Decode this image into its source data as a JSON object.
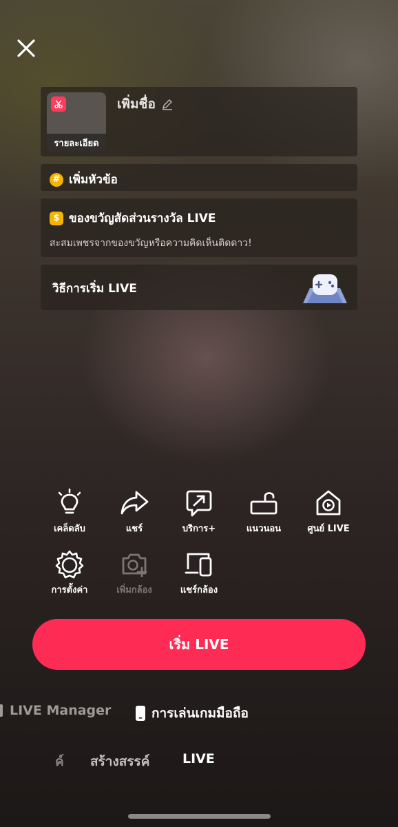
{
  "header": {
    "close_icon": "close-icon"
  },
  "title_card": {
    "add_title": "เพิ่มชื่อ",
    "thumbnail_label": "รายละเอียด",
    "edit_icon": "pencil-icon"
  },
  "topic": {
    "label": "เพิ่มหัวข้อ",
    "icon": "hash-icon"
  },
  "rewards": {
    "title": "ของขวัญสัดส่วนรางวัล LIVE",
    "subtitle": "สะสมเพชรจากของขวัญหรือความคิดเห็นติดดาว!",
    "icon": "dollar-icon"
  },
  "guide": {
    "label": "วิธีการเริ่ม LIVE",
    "icon": "gamepad-illustration"
  },
  "tools": [
    {
      "label": "เคล็ดลับ",
      "icon": "lightbulb-icon"
    },
    {
      "label": "แชร์",
      "icon": "share-icon"
    },
    {
      "label": "บริการ+",
      "icon": "service-icon"
    },
    {
      "label": "แนวนอน",
      "icon": "landscape-icon"
    },
    {
      "label": "ศูนย์ LIVE",
      "icon": "live-center-icon"
    },
    {
      "label": "การตั้งค่า",
      "icon": "settings-icon"
    },
    {
      "label": "เพิ่มกล้อง",
      "icon": "add-camera-icon"
    },
    {
      "label": "แชร์กล้อง",
      "icon": "share-camera-icon"
    }
  ],
  "start_button": {
    "label": "เริ่ม LIVE"
  },
  "modes": {
    "manager": "LIVE Manager",
    "mobile_gaming": "การเล่นเกมมือถือ"
  },
  "bottom_tabs": {
    "partial": "ค์",
    "create": "สร้างสรรค์",
    "live": "LIVE"
  },
  "colors": {
    "accent": "#fe2c55",
    "coin": "#f5b400"
  }
}
